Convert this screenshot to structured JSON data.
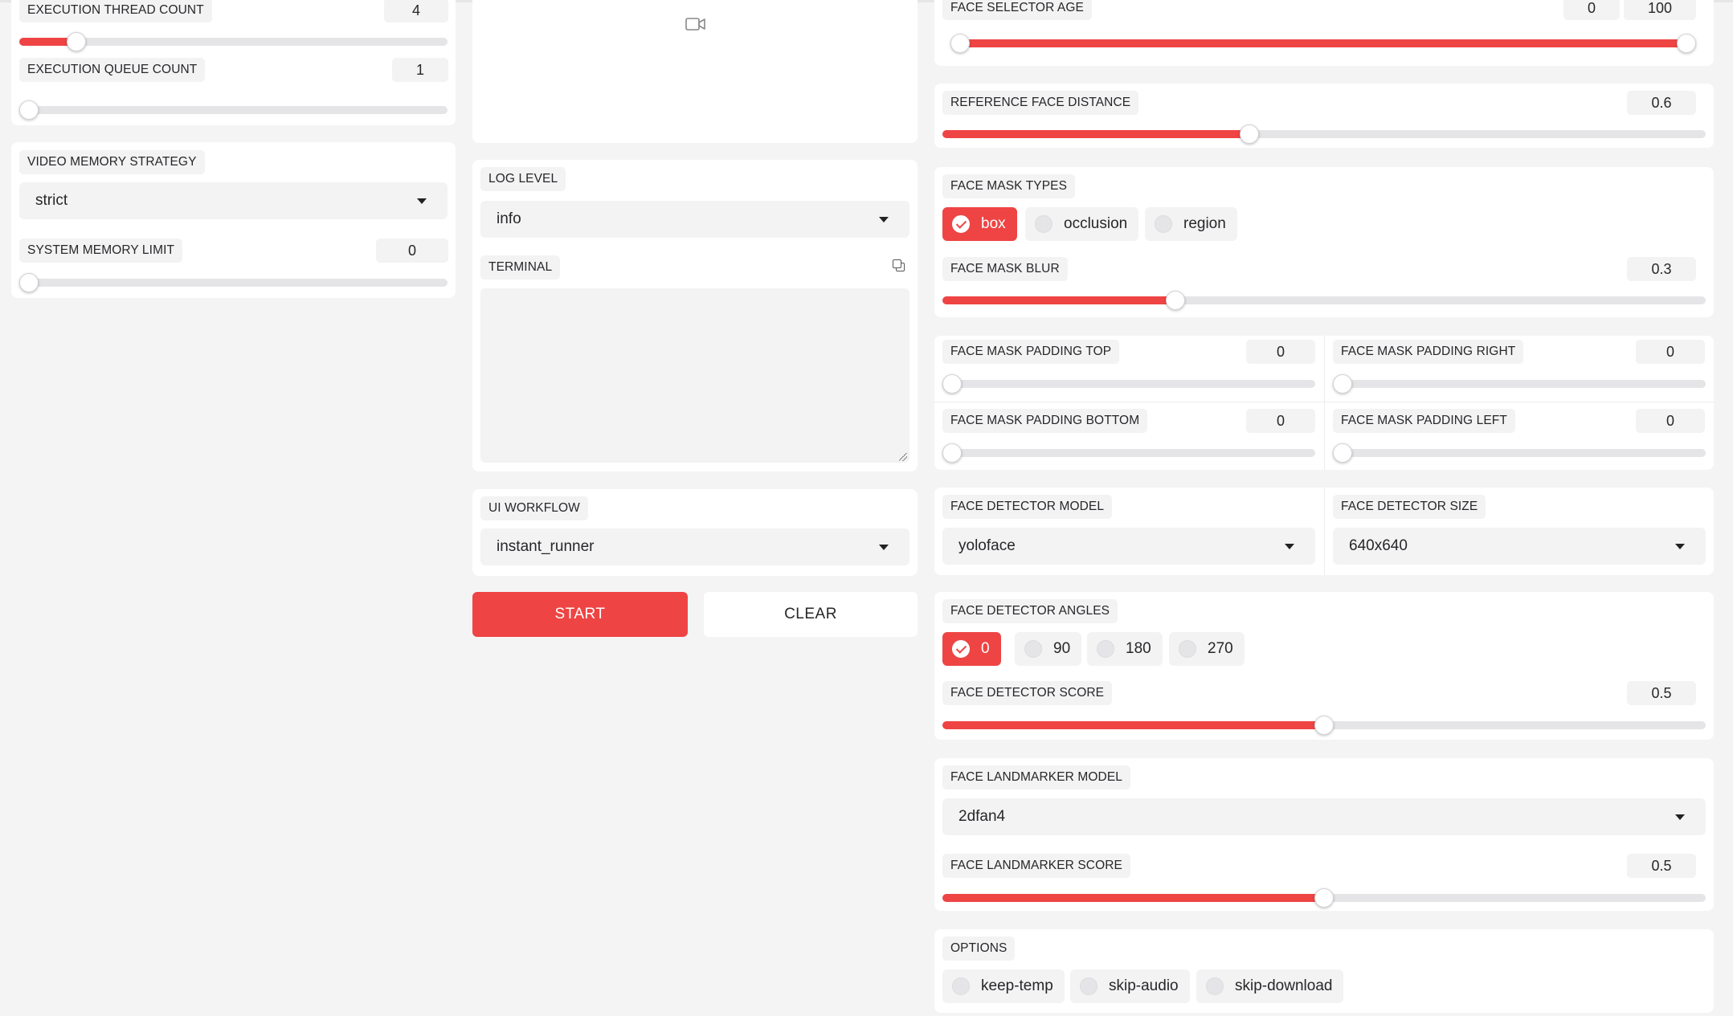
{
  "colors": {
    "accent": "#ef4444",
    "background": "#f4f4f5",
    "panel": "#ffffff"
  },
  "left": {
    "execution_thread_count": {
      "label": "EXECUTION THREAD COUNT",
      "value": "4",
      "fraction": 0.115
    },
    "execution_queue_count": {
      "label": "EXECUTION QUEUE COUNT",
      "value": "1",
      "fraction": 0.0
    },
    "video_memory_strategy": {
      "label": "VIDEO MEMORY STRATEGY",
      "value": "strict"
    },
    "system_memory_limit": {
      "label": "SYSTEM MEMORY LIMIT",
      "value": "0",
      "fraction": 0.0
    }
  },
  "middle": {
    "preview": {
      "icon": "video-camera-icon"
    },
    "log_level": {
      "label": "LOG LEVEL",
      "value": "info"
    },
    "terminal": {
      "label": "TERMINAL",
      "value": ""
    },
    "ui_workflow": {
      "label": "UI WORKFLOW",
      "value": "instant_runner"
    },
    "start_label": "START",
    "clear_label": "CLEAR"
  },
  "right": {
    "face_selector_age": {
      "label": "FACE SELECTOR AGE",
      "min_value": "0",
      "max_value": "100",
      "fraction_start": 0.0,
      "fraction_end": 1.0
    },
    "reference_face_distance": {
      "label": "REFERENCE FACE DISTANCE",
      "value": "0.6",
      "fraction": 0.4
    },
    "face_mask_types": {
      "label": "FACE MASK TYPES",
      "options": [
        {
          "label": "box",
          "checked": true
        },
        {
          "label": "occlusion",
          "checked": false
        },
        {
          "label": "region",
          "checked": false
        }
      ]
    },
    "face_mask_blur": {
      "label": "FACE MASK BLUR",
      "value": "0.3",
      "fraction": 0.3
    },
    "face_mask_padding_top": {
      "label": "FACE MASK PADDING TOP",
      "value": "0",
      "fraction": 0.0
    },
    "face_mask_padding_right": {
      "label": "FACE MASK PADDING RIGHT",
      "value": "0",
      "fraction": 0.0
    },
    "face_mask_padding_bottom": {
      "label": "FACE MASK PADDING BOTTOM",
      "value": "0",
      "fraction": 0.0
    },
    "face_mask_padding_left": {
      "label": "FACE MASK PADDING LEFT",
      "value": "0",
      "fraction": 0.0
    },
    "face_detector_model": {
      "label": "FACE DETECTOR MODEL",
      "value": "yoloface"
    },
    "face_detector_size": {
      "label": "FACE DETECTOR SIZE",
      "value": "640x640"
    },
    "face_detector_angles": {
      "label": "FACE DETECTOR ANGLES",
      "options": [
        {
          "label": "0",
          "checked": true
        },
        {
          "label": "90",
          "checked": false
        },
        {
          "label": "180",
          "checked": false
        },
        {
          "label": "270",
          "checked": false
        }
      ]
    },
    "face_detector_score": {
      "label": "FACE DETECTOR SCORE",
      "value": "0.5",
      "fraction": 0.5
    },
    "face_landmarker_model": {
      "label": "FACE LANDMARKER MODEL",
      "value": "2dfan4"
    },
    "face_landmarker_score": {
      "label": "FACE LANDMARKER SCORE",
      "value": "0.5",
      "fraction": 0.5
    },
    "options": {
      "label": "OPTIONS",
      "items": [
        {
          "label": "keep-temp",
          "checked": false
        },
        {
          "label": "skip-audio",
          "checked": false
        },
        {
          "label": "skip-download",
          "checked": false
        }
      ]
    }
  }
}
